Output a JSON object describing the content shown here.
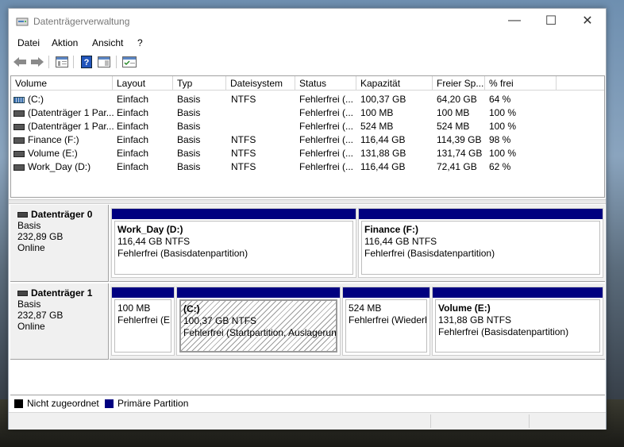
{
  "window": {
    "title": "Datenträgerverwaltung",
    "minimize": "—",
    "maximize": "☐",
    "close": "✕"
  },
  "menu": [
    "Datei",
    "Aktion",
    "Ansicht",
    "?"
  ],
  "toolbar": {
    "icons": [
      "back-arrow-icon",
      "forward-arrow-icon",
      "properties-icon",
      "help-icon",
      "show-hide-icon",
      "settings-icon"
    ]
  },
  "volume_table": {
    "columns": [
      "Volume",
      "Layout",
      "Typ",
      "Dateisystem",
      "Status",
      "Kapazität",
      "Freier Sp...",
      "% frei"
    ],
    "rows": [
      {
        "volume": "(C:)",
        "layout": "Einfach",
        "typ": "Basis",
        "fs": "NTFS",
        "status": "Fehlerfrei (...",
        "cap": "100,37 GB",
        "free": "64,20 GB",
        "pct": "64 %",
        "icon": "striped"
      },
      {
        "volume": "(Datenträger 1 Par...",
        "layout": "Einfach",
        "typ": "Basis",
        "fs": "",
        "status": "Fehlerfrei (...",
        "cap": "100 MB",
        "free": "100 MB",
        "pct": "100 %",
        "icon": "plain"
      },
      {
        "volume": "(Datenträger 1 Par...",
        "layout": "Einfach",
        "typ": "Basis",
        "fs": "",
        "status": "Fehlerfrei (...",
        "cap": "524 MB",
        "free": "524 MB",
        "pct": "100 %",
        "icon": "plain"
      },
      {
        "volume": "Finance (F:)",
        "layout": "Einfach",
        "typ": "Basis",
        "fs": "NTFS",
        "status": "Fehlerfrei (...",
        "cap": "116,44 GB",
        "free": "114,39 GB",
        "pct": "98 %",
        "icon": "plain"
      },
      {
        "volume": "Volume (E:)",
        "layout": "Einfach",
        "typ": "Basis",
        "fs": "NTFS",
        "status": "Fehlerfrei (...",
        "cap": "131,88 GB",
        "free": "131,74 GB",
        "pct": "100 %",
        "icon": "plain"
      },
      {
        "volume": "Work_Day (D:)",
        "layout": "Einfach",
        "typ": "Basis",
        "fs": "NTFS",
        "status": "Fehlerfrei (...",
        "cap": "116,44 GB",
        "free": "72,41 GB",
        "pct": "62 %",
        "icon": "plain"
      }
    ]
  },
  "disks": [
    {
      "name": "Datenträger 0",
      "type": "Basis",
      "size": "232,89 GB",
      "state": "Online",
      "partitions": [
        {
          "title": "Work_Day  (D:)",
          "size": "116,44 GB NTFS",
          "status": "Fehlerfrei (Basisdatenpartition)"
        },
        {
          "title": "Finance  (F:)",
          "size": "116,44 GB NTFS",
          "status": "Fehlerfrei (Basisdatenpartition)"
        }
      ]
    },
    {
      "name": "Datenträger 1",
      "type": "Basis",
      "size": "232,87 GB",
      "state": "Online",
      "partitions": [
        {
          "title": "",
          "size": "100 MB",
          "status": "Fehlerfrei (EF"
        },
        {
          "title": "(C:)",
          "size": "100,37 GB NTFS",
          "status": "Fehlerfrei (Startpartition, Auslagerungsdatei"
        },
        {
          "title": "",
          "size": "524 MB",
          "status": "Fehlerfrei (Wiederh"
        },
        {
          "title": "Volume  (E:)",
          "size": "131,88 GB NTFS",
          "status": "Fehlerfrei (Basisdatenpartition)"
        }
      ]
    }
  ],
  "legend": [
    {
      "label": "Nicht zugeordnet",
      "color": "#000000"
    },
    {
      "label": "Primäre Partition",
      "color": "#000080"
    }
  ],
  "colors": {
    "primary_partition": "#000080",
    "unallocated": "#000000"
  }
}
